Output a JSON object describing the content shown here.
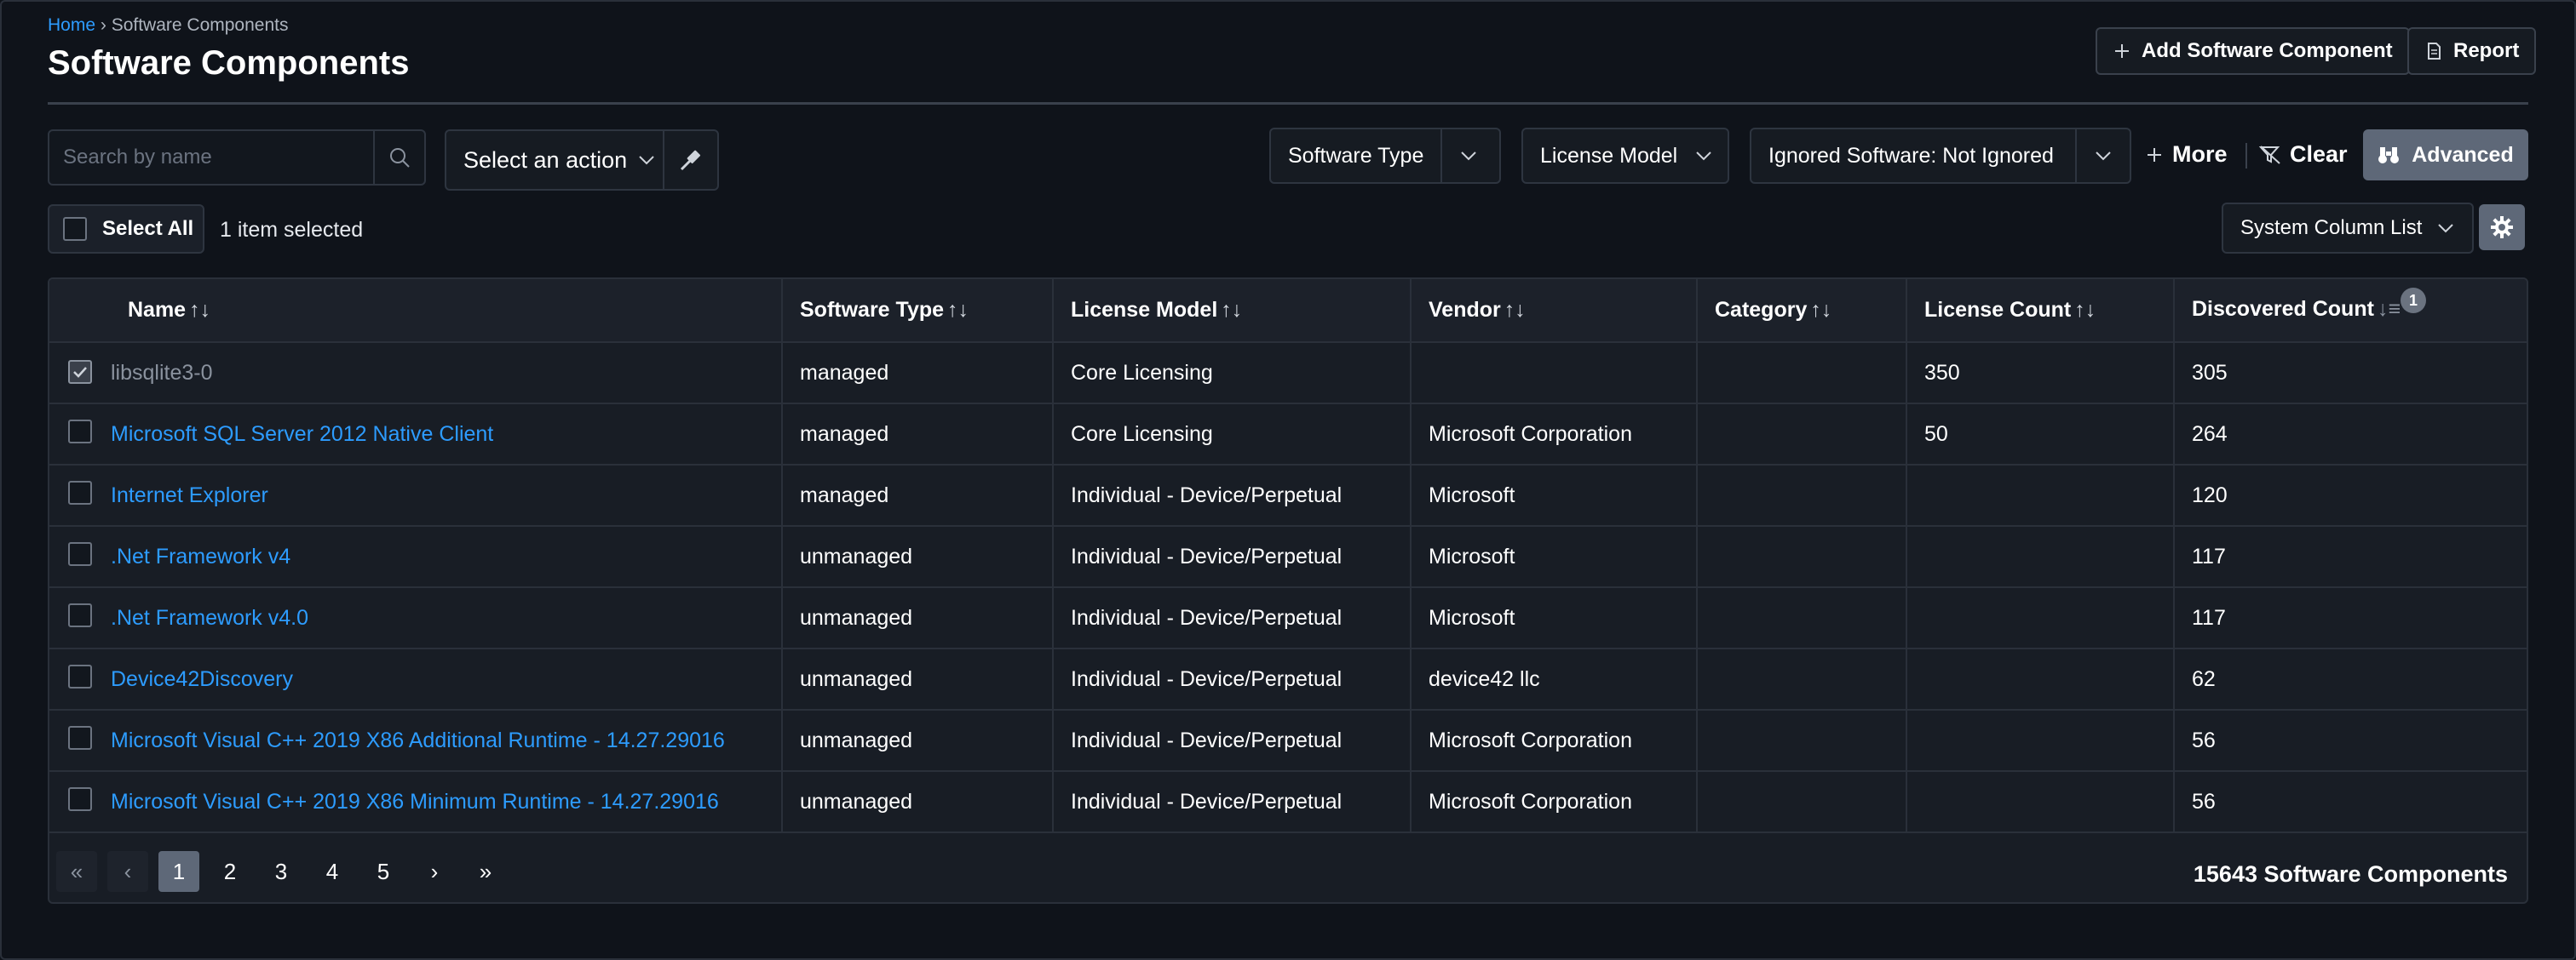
{
  "breadcrumb": {
    "home": "Home",
    "separator": " › ",
    "current": "Software Components"
  },
  "page_title": "Software Components",
  "header_buttons": {
    "add": "Add Software Component",
    "report": "Report"
  },
  "search": {
    "placeholder": "Search by name",
    "value": ""
  },
  "action_select": {
    "label": "Select an action"
  },
  "filters": [
    {
      "label": "Software Type"
    },
    {
      "label": "License Model"
    },
    {
      "label": "Ignored Software: Not Ignored"
    }
  ],
  "toolbar": {
    "more": "More",
    "clear": "Clear",
    "advanced": "Advanced"
  },
  "selection": {
    "select_all": "Select All",
    "count_text": "1 item selected"
  },
  "column_list": {
    "label": "System Column List"
  },
  "columns": [
    "Name",
    "Software Type",
    "License Model",
    "Vendor",
    "Category",
    "License Count",
    "Discovered Count"
  ],
  "sort_badge": "1",
  "rows": [
    {
      "checked": true,
      "name": "libsqlite3-0",
      "type": "managed",
      "license_model": "Core Licensing",
      "vendor": "",
      "category": "",
      "license_count": "350",
      "discovered": "305"
    },
    {
      "checked": false,
      "name": "Microsoft SQL Server 2012 Native Client",
      "type": "managed",
      "license_model": "Core Licensing",
      "vendor": "Microsoft Corporation",
      "category": "",
      "license_count": "50",
      "discovered": "264"
    },
    {
      "checked": false,
      "name": "Internet Explorer",
      "type": "managed",
      "license_model": "Individual - Device/Perpetual",
      "vendor": "Microsoft",
      "category": "",
      "license_count": "",
      "discovered": "120"
    },
    {
      "checked": false,
      "name": ".Net Framework v4",
      "type": "unmanaged",
      "license_model": "Individual - Device/Perpetual",
      "vendor": "Microsoft",
      "category": "",
      "license_count": "",
      "discovered": "117"
    },
    {
      "checked": false,
      "name": ".Net Framework v4.0",
      "type": "unmanaged",
      "license_model": "Individual - Device/Perpetual",
      "vendor": "Microsoft",
      "category": "",
      "license_count": "",
      "discovered": "117"
    },
    {
      "checked": false,
      "name": "Device42Discovery",
      "type": "unmanaged",
      "license_model": "Individual - Device/Perpetual",
      "vendor": "device42 llc",
      "category": "",
      "license_count": "",
      "discovered": "62"
    },
    {
      "checked": false,
      "name": "Microsoft Visual C++ 2019 X86 Additional Runtime - 14.27.29016",
      "type": "unmanaged",
      "license_model": "Individual - Device/Perpetual",
      "vendor": "Microsoft Corporation",
      "category": "",
      "license_count": "",
      "discovered": "56"
    },
    {
      "checked": false,
      "name": "Microsoft Visual C++ 2019 X86 Minimum Runtime - 14.27.29016",
      "type": "unmanaged",
      "license_model": "Individual - Device/Perpetual",
      "vendor": "Microsoft Corporation",
      "category": "",
      "license_count": "",
      "discovered": "56"
    }
  ],
  "pagination": {
    "pages": [
      "1",
      "2",
      "3",
      "4",
      "5"
    ],
    "current": "1"
  },
  "total_text": "15643 Software Components",
  "colors": {
    "link": "#2d9cff",
    "background": "#0f131a",
    "accent_button": "#5e6878"
  }
}
